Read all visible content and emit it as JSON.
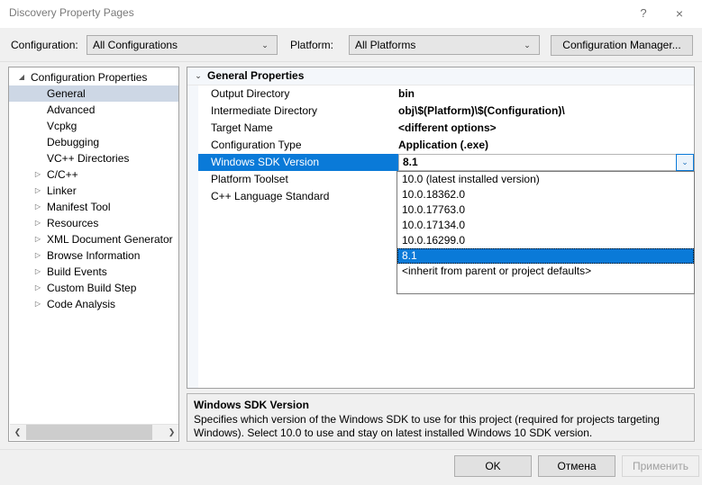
{
  "window": {
    "title": "Discovery Property Pages",
    "help_icon": "question-mark-icon",
    "help_glyph": "?",
    "close_icon": "close-icon",
    "close_glyph": "×"
  },
  "configbar": {
    "configuration_label": "Configuration:",
    "configuration_value": "All Configurations",
    "platform_label": "Platform:",
    "platform_value": "All Platforms",
    "configuration_manager_label": "Configuration Manager...",
    "arrow_glyph": "⌄"
  },
  "tree": {
    "root_label": "Configuration Properties",
    "root_arrow": "◢",
    "collapsed_arrow": "▷",
    "items": [
      {
        "label": "General",
        "level": 1,
        "expandable": false,
        "selected": true
      },
      {
        "label": "Advanced",
        "level": 1,
        "expandable": false,
        "selected": false
      },
      {
        "label": "Vcpkg",
        "level": 1,
        "expandable": false,
        "selected": false
      },
      {
        "label": "Debugging",
        "level": 1,
        "expandable": false,
        "selected": false
      },
      {
        "label": "VC++ Directories",
        "level": 1,
        "expandable": false,
        "selected": false
      },
      {
        "label": "C/C++",
        "level": 1,
        "expandable": true,
        "selected": false
      },
      {
        "label": "Linker",
        "level": 1,
        "expandable": true,
        "selected": false
      },
      {
        "label": "Manifest Tool",
        "level": 1,
        "expandable": true,
        "selected": false
      },
      {
        "label": "Resources",
        "level": 1,
        "expandable": true,
        "selected": false
      },
      {
        "label": "XML Document Generator",
        "level": 1,
        "expandable": true,
        "selected": false
      },
      {
        "label": "Browse Information",
        "level": 1,
        "expandable": true,
        "selected": false
      },
      {
        "label": "Build Events",
        "level": 1,
        "expandable": true,
        "selected": false
      },
      {
        "label": "Custom Build Step",
        "level": 1,
        "expandable": true,
        "selected": false
      },
      {
        "label": "Code Analysis",
        "level": 1,
        "expandable": true,
        "selected": false
      }
    ],
    "scrollbar": {
      "left_glyph": "❮",
      "right_glyph": "❯"
    }
  },
  "grid": {
    "category_label": "General Properties",
    "category_arrow": "⌄",
    "rows": [
      {
        "name": "Output Directory",
        "value": "bin",
        "selected": false
      },
      {
        "name": "Intermediate Directory",
        "value": "obj\\$(Platform)\\$(Configuration)\\",
        "selected": false
      },
      {
        "name": "Target Name",
        "value": "<different options>",
        "selected": false
      },
      {
        "name": "Configuration Type",
        "value": "Application (.exe)",
        "selected": false
      },
      {
        "name": "Windows SDK Version",
        "value": "8.1",
        "selected": true
      },
      {
        "name": "Platform Toolset",
        "value": "",
        "selected": false
      },
      {
        "name": "C++ Language Standard",
        "value": "",
        "selected": false
      }
    ],
    "dropdown_button_glyph": "⌄"
  },
  "dropdown": {
    "options": [
      {
        "label": "10.0 (latest installed version)",
        "selected": false
      },
      {
        "label": "10.0.18362.0",
        "selected": false
      },
      {
        "label": "10.0.17763.0",
        "selected": false
      },
      {
        "label": "10.0.17134.0",
        "selected": false
      },
      {
        "label": "10.0.16299.0",
        "selected": false
      },
      {
        "label": "8.1",
        "selected": true
      },
      {
        "label": "<inherit from parent or project defaults>",
        "selected": false
      }
    ]
  },
  "description": {
    "title": "Windows SDK Version",
    "body": "Specifies which version of the Windows SDK to use for this project (required for projects targeting Windows). Select 10.0 to use and stay on latest installed Windows 10 SDK version."
  },
  "footer": {
    "ok_label": "OK",
    "cancel_label": "Отмена",
    "apply_label": "Применить",
    "apply_disabled": true
  },
  "colors": {
    "accent": "#0a7ad8",
    "tree_selection": "#cdd7e5",
    "dialog_bg": "#f0f0f0",
    "category_bg": "#f4f7fb"
  }
}
